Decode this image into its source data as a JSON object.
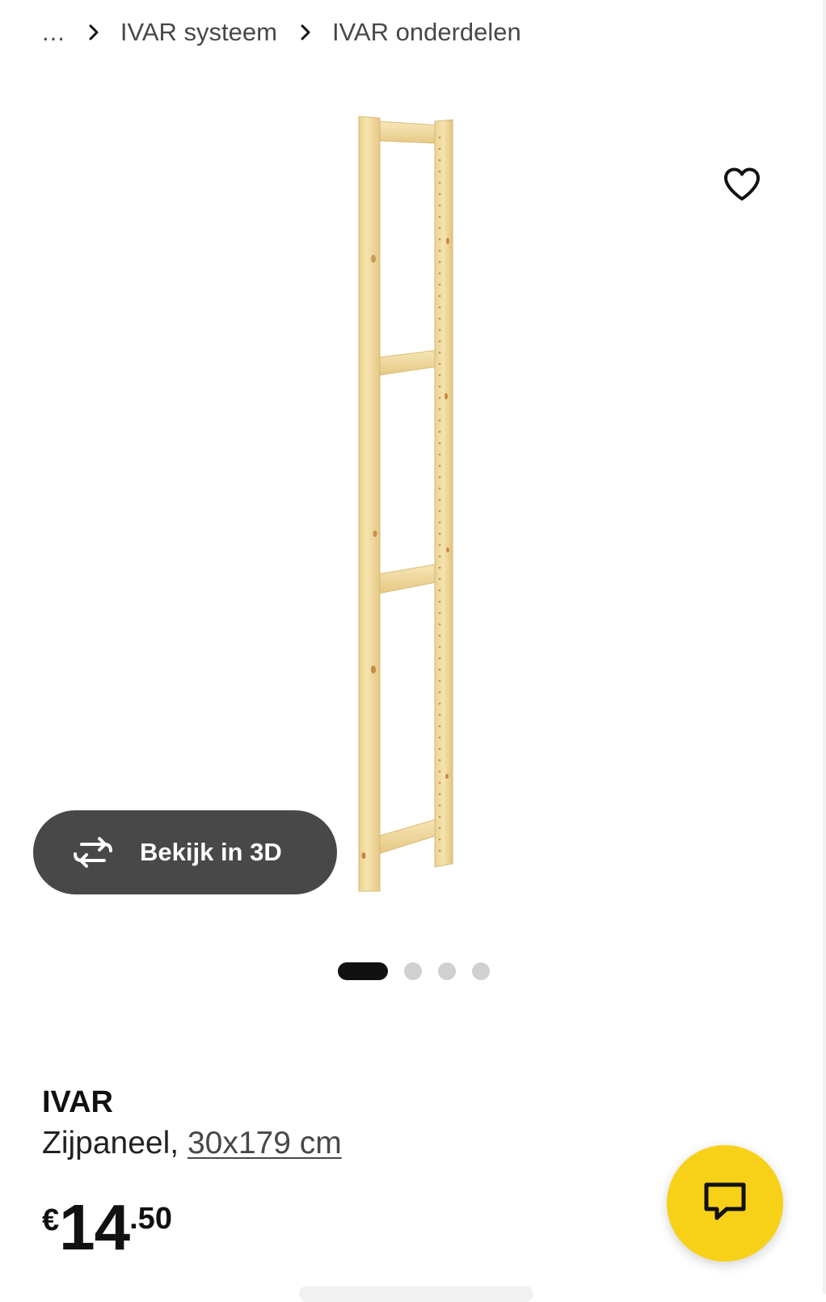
{
  "breadcrumb": {
    "ellipsis": "...",
    "items": [
      "IVAR systeem",
      "IVAR onderdelen"
    ]
  },
  "gallery": {
    "image_subject": "IVAR side unit, untreated pine",
    "view_3d_label": "Bekijk in 3D",
    "dot_count": 4,
    "active_dot": 0
  },
  "product": {
    "name": "IVAR",
    "description": "Zijpaneel,",
    "size": "30x179 cm",
    "price": {
      "currency": "€",
      "integer": "14",
      "decimal": ".50"
    }
  },
  "icons": {
    "favorite": "heart-outline-icon",
    "rotate": "rotate-3d-icon",
    "chat": "chat-bubble-icon",
    "separator": "chevron-right-icon"
  },
  "colors": {
    "accent_yellow": "#f7d117",
    "button_dark": "#484848",
    "text": "#111111",
    "wood": "#f1dca0"
  }
}
